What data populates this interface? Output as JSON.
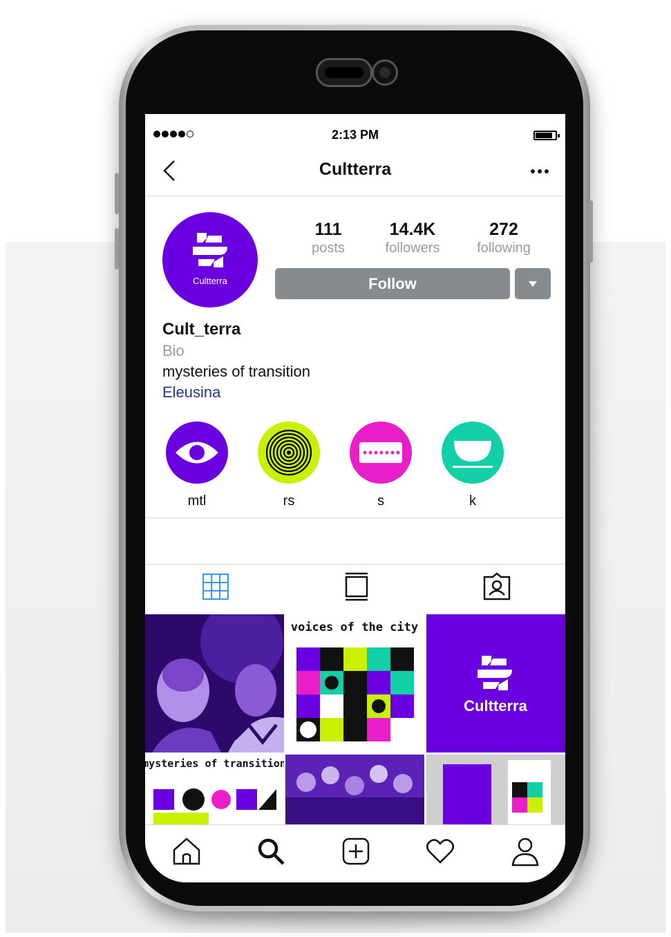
{
  "status_bar": {
    "time": "2:13 PM",
    "signal_icon": "signal-dots-icon",
    "battery_icon": "battery-icon"
  },
  "header": {
    "title": "Cultterra",
    "back_icon": "chevron-left-icon",
    "more_icon": "more-horizontal-icon"
  },
  "profile": {
    "avatar_text": "Cultterra",
    "stats": [
      {
        "value": "111",
        "label": "posts"
      },
      {
        "value": "14.4K",
        "label": "followers"
      },
      {
        "value": "272",
        "label": "following"
      }
    ],
    "follow_label": "Follow",
    "username": "Cult_terra",
    "bio_label": "Bio",
    "bio_text": "mysteries of transition",
    "link": "Eleusina"
  },
  "highlights": [
    {
      "label": "mtl",
      "color": "#6a00e0",
      "icon": "eye-icon"
    },
    {
      "label": "rs",
      "color": "#c8f000",
      "icon": "concentric-circles-icon"
    },
    {
      "label": "s",
      "color": "#e91ec9",
      "icon": "dots-bar-icon"
    },
    {
      "label": "k",
      "color": "#12cfa8",
      "icon": "bowl-icon"
    }
  ],
  "tabs": [
    {
      "name": "grid-view-icon",
      "active": true
    },
    {
      "name": "feed-view-icon",
      "active": false
    },
    {
      "name": "tagged-photos-icon",
      "active": false
    }
  ],
  "posts": [
    {
      "type": "photo-purple"
    },
    {
      "type": "poster",
      "caption": "voices of the city"
    },
    {
      "type": "logo",
      "caption": "Cultterra"
    },
    {
      "type": "poster",
      "caption": "mysteries of transition"
    },
    {
      "type": "photo-purple"
    },
    {
      "type": "mockup"
    }
  ],
  "bottom_nav": [
    "home-icon",
    "search-icon",
    "add-post-icon",
    "heart-icon",
    "profile-icon"
  ],
  "colors": {
    "brand_purple": "#6a00e0",
    "lime": "#c8f000",
    "magenta": "#e91ec9",
    "teal": "#12cfa8",
    "button_gray": "#868b90",
    "link_blue": "#1d3b87"
  }
}
